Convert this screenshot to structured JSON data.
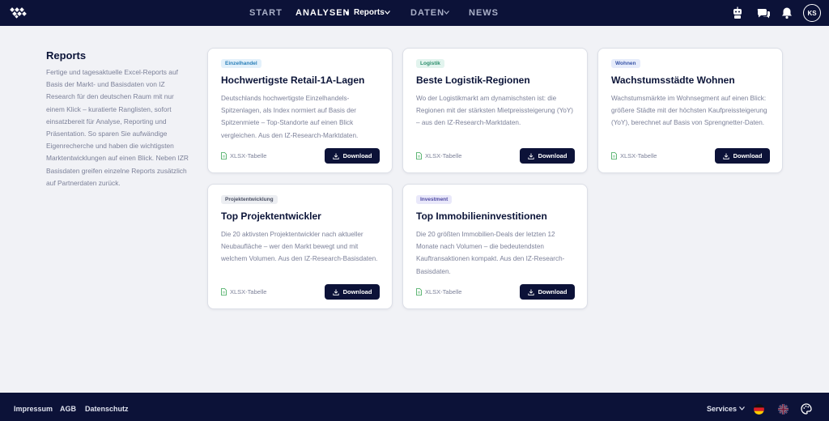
{
  "nav": {
    "items": [
      {
        "label": "START"
      },
      {
        "label": "ANALYSEN"
      },
      {
        "label": "Reports"
      },
      {
        "label": "DATEN"
      },
      {
        "label": "NEWS"
      }
    ],
    "avatar_initials": "KS",
    "icons": [
      "logo-icon",
      "robot-icon",
      "chat-icon",
      "bell-icon"
    ]
  },
  "intro": {
    "title": "Reports",
    "text": "Fertige und tagesaktuelle Excel-Reports auf Basis der Markt- und Basisdaten von IZ Research für den deutschen Raum mit nur einem Klick – kuratierte Ranglisten, sofort einsatzbereit für Analyse, Reporting und Präsentation. So sparen Sie aufwändige Eigenrecherche und haben die wichtigsten Marktentwicklungen auf einen Blick. Neben IZR Basisdaten greifen einzelne Reports zusätzlich auf Partnerdaten zurück."
  },
  "cards": [
    {
      "tag": "Einzelhandel",
      "tag_color": "#e3f1fb",
      "tag_text_color": "#2a7fb8",
      "title": "Hochwertigste Retail-1A-Lagen",
      "description": "Deutschlands hochwertigste Einzelhandels-Spitzenlagen, als Index normiert auf Basis der Spitzenmiete – Top-Standorte auf einen Blick vergleichen. Aus den IZ-Research-Marktdaten.",
      "file": "XLSX-Tabelle",
      "button": "Download"
    },
    {
      "tag": "Logistik",
      "tag_color": "#e2f4ee",
      "tag_text_color": "#2f8f6d",
      "title": "Beste Logistik-Regionen",
      "description": "Wo der Logistikmarkt am dynamischsten ist: die Regionen mit der stärksten Mietpreissteigerung (YoY) – aus den IZ-Research-Marktdaten.",
      "file": "XLSX-Tabelle",
      "button": "Download"
    },
    {
      "tag": "Wohnen",
      "tag_color": "#e6ecfb",
      "tag_text_color": "#3a56a8",
      "title": "Wachstumsstädte Wohnen",
      "description": "Wachstumsmärkte im Wohnsegment auf einen Blick: größere Städte mit der höchsten Kaufpreissteigerung (YoY), berechnet auf Basis von Sprengnetter-Daten.",
      "file": "XLSX-Tabelle",
      "button": "Download"
    },
    {
      "tag": "Projektentwicklung",
      "tag_color": "#eceef2",
      "tag_text_color": "#4a4f63",
      "title": "Top Projektentwickler",
      "description": "Die 20 aktivsten Projektentwickler nach aktueller Neubaufläche – wer den Markt bewegt und mit welchem Volumen. Aus den IZ-Research-Basisdaten.",
      "file": "XLSX-Tabelle",
      "button": "Download"
    },
    {
      "tag": "Investment",
      "tag_color": "#e9e8fa",
      "tag_text_color": "#4f4aa3",
      "title": "Top Immobilieninvestitionen",
      "description": "Die 20 größten Immobilien-Deals der letzten 12 Monate nach Volumen – die bedeutendsten Kauftransaktionen kompakt. Aus den IZ-Research-Basisdaten.",
      "file": "XLSX-Tabelle",
      "button": "Download"
    }
  ],
  "footer": {
    "links": [
      "Impressum",
      "AGB",
      "Datenschutz"
    ],
    "services": "Services",
    "icons": [
      "flag-de-icon",
      "flag-uk-icon",
      "palette-icon"
    ]
  }
}
